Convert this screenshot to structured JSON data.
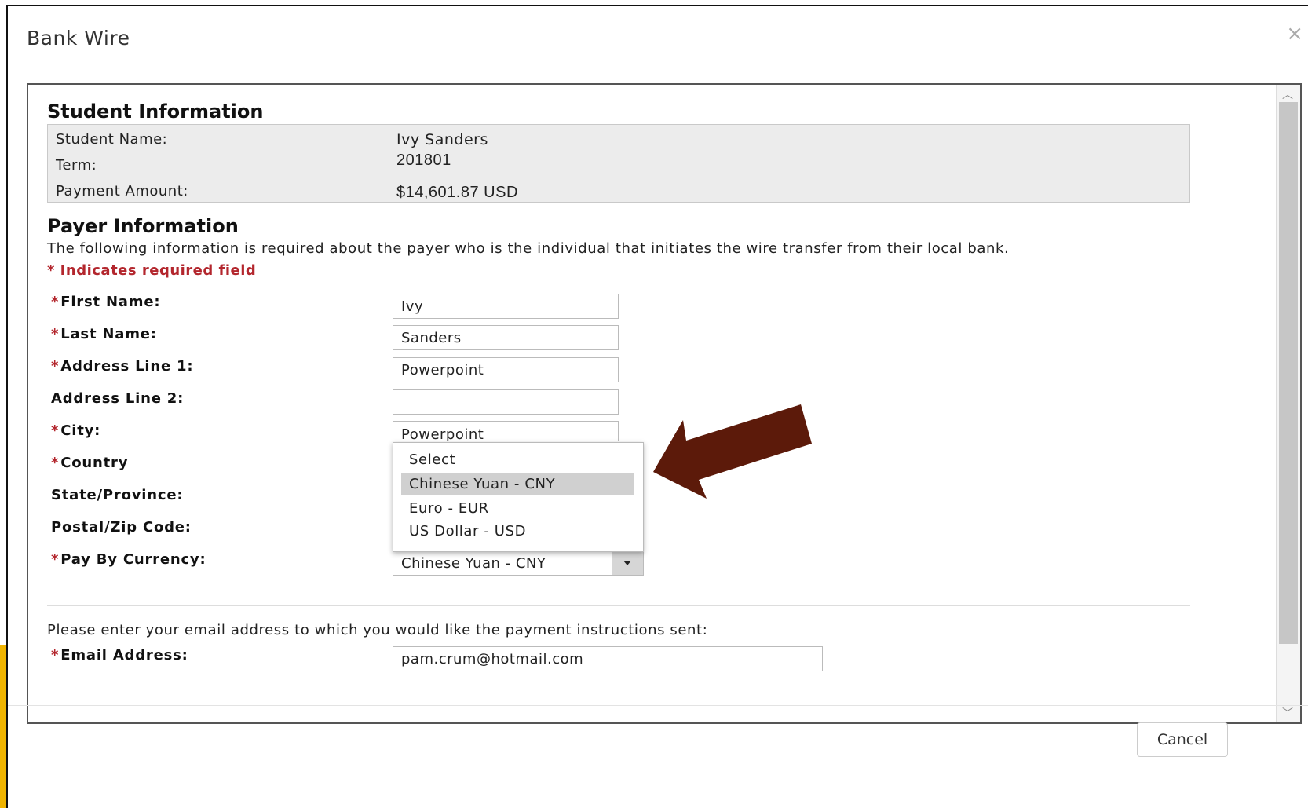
{
  "dialog": {
    "title": "Bank Wire",
    "close_symbol": "×"
  },
  "student": {
    "heading": "Student Information",
    "rows": [
      {
        "label": "Student Name:",
        "value": "Ivy Sanders"
      },
      {
        "label": "Term:",
        "value": "201801"
      },
      {
        "label": "Payment Amount:",
        "value": "$14,601.87 USD"
      }
    ]
  },
  "payer": {
    "heading": "Payer Information",
    "description": "The following information is required about the payer who is the individual that initiates the wire transfer from their local bank.",
    "required_note": "* Indicates required field",
    "required_marker": "*",
    "fields": {
      "first_name": {
        "label": "First Name:",
        "value": "Ivy"
      },
      "last_name": {
        "label": "Last Name:",
        "value": "Sanders"
      },
      "address1": {
        "label": "Address Line 1:",
        "value": "Powerpoint"
      },
      "address2": {
        "label": "Address Line 2:",
        "value": ""
      },
      "city": {
        "label": "City:",
        "value": "Powerpoint"
      },
      "country": {
        "label": "Country"
      },
      "state": {
        "label": "State/Province:"
      },
      "postal": {
        "label": "Postal/Zip Code:"
      },
      "currency": {
        "label": "Pay By Currency:",
        "value": "Chinese Yuan - CNY"
      }
    },
    "currency_options": [
      "Select",
      "Chinese Yuan - CNY",
      "Euro - EUR",
      "US Dollar - USD"
    ],
    "currency_highlighted": "Chinese Yuan - CNY"
  },
  "email": {
    "description": "Please enter your email address to which you would like the payment instructions sent:",
    "label": "Email Address:",
    "value": "pam.crum@hotmail.com"
  },
  "footer": {
    "cancel_label": "Cancel"
  },
  "colors": {
    "required_red": "#b3262d",
    "annotation_arrow": "#5c1a0a",
    "side_accent": "#f0b400"
  },
  "icons": {
    "close": "close-icon",
    "dropdown": "chevron-down-icon",
    "annotation": "arrow-annotation-icon"
  }
}
